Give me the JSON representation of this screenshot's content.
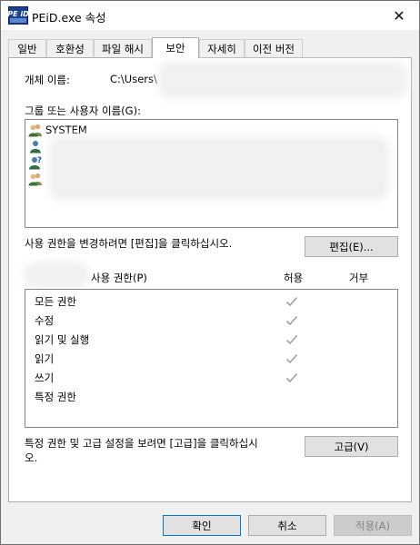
{
  "window": {
    "title": "PEiD.exe 속성",
    "icon_text": "PE iD",
    "close_glyph": "✕"
  },
  "tabs": [
    {
      "label": "일반",
      "active": false
    },
    {
      "label": "호환성",
      "active": false
    },
    {
      "label": "파일 해시",
      "active": false
    },
    {
      "label": "보안",
      "active": true
    },
    {
      "label": "자세히",
      "active": false
    },
    {
      "label": "이전 버전",
      "active": false
    }
  ],
  "object": {
    "label": "개체 이름:",
    "value": "C:\\Users\\"
  },
  "groups": {
    "label": "그룹 또는 사용자 이름(G):",
    "items": [
      {
        "name": "SYSTEM",
        "icon": "group-users-icon"
      },
      {
        "name": "",
        "icon": "user-icon"
      },
      {
        "name": "",
        "icon": "unknown-user-icon"
      },
      {
        "name": "",
        "icon": "group-users-icon"
      }
    ]
  },
  "edit": {
    "hint": "사용 권한을 변경하려면 [편집]을 클릭하십시오.",
    "button": "편집(E)..."
  },
  "permissions": {
    "header_label": "사용 권한(P)",
    "col_allow": "허용",
    "col_deny": "거부",
    "rows": [
      {
        "name": "모든 권한",
        "allow": true,
        "deny": false
      },
      {
        "name": "수정",
        "allow": true,
        "deny": false
      },
      {
        "name": "읽기 및 실행",
        "allow": true,
        "deny": false
      },
      {
        "name": "읽기",
        "allow": true,
        "deny": false
      },
      {
        "name": "쓰기",
        "allow": true,
        "deny": false
      },
      {
        "name": "특정 권한",
        "allow": false,
        "deny": false
      }
    ]
  },
  "advanced": {
    "hint_line1": "특정 권한 및 고급 설정을 보려면 [고급]을 클릭하십시",
    "hint_line2": "오.",
    "button": "고급(V)"
  },
  "footer": {
    "ok": "확인",
    "cancel": "취소",
    "apply": "적용(A)"
  }
}
